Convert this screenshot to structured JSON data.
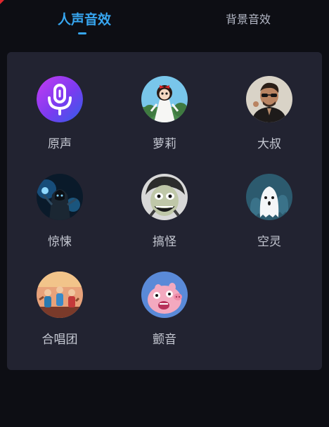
{
  "tabs": {
    "voice_effects": "人声音效",
    "background_effects": "背景音效"
  },
  "accent_color": "#37a6f0",
  "effects": [
    {
      "label": "原声",
      "icon": "microphone-icon"
    },
    {
      "label": "萝莉",
      "icon": "loli-girl-avatar"
    },
    {
      "label": "大叔",
      "icon": "uncle-avatar"
    },
    {
      "label": "惊悚",
      "icon": "thriller-avatar"
    },
    {
      "label": "搞怪",
      "icon": "funny-face-avatar"
    },
    {
      "label": "空灵",
      "icon": "ghost-avatar"
    },
    {
      "label": "合唱团",
      "icon": "choir-avatar"
    },
    {
      "label": "颤音",
      "icon": "pig-avatar"
    }
  ]
}
